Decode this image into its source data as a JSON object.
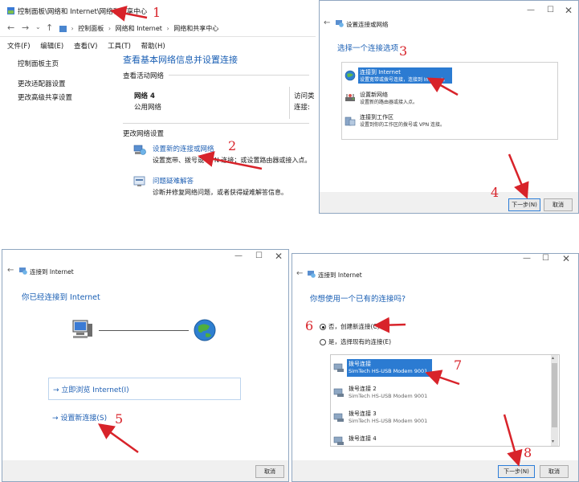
{
  "panel1": {
    "address_title": "控制面板\\网络和 Internet\\网络和共享中心",
    "addr_icon": "control-panel-icon",
    "nav_path": [
      "控制面板",
      "网络和 Internet",
      "网络和共享中心"
    ],
    "menu": [
      "文件(F)",
      "编辑(E)",
      "查看(V)",
      "工具(T)",
      "帮助(H)"
    ],
    "sidebar": [
      "控制面板主页",
      "更改适配器设置",
      "更改高级共享设置"
    ],
    "heading": "查看基本网络信息并设置连接",
    "active_label": "查看活动网络",
    "network_name": "网络 4",
    "network_type": "公用网络",
    "access_type_label": "访问类",
    "connections_label": "连接:",
    "change_label": "更改网络设置",
    "setup_link": "设置新的连接或网络",
    "setup_desc": "设置宽带、拨号或 VPN 连接；或设置路由器或接入点。",
    "troubleshoot_link": "问题疑难解答",
    "troubleshoot_desc": "诊断并修复网络问题，或者获得疑难解答信息。"
  },
  "panel2": {
    "title": "设置连接或网络",
    "heading": "选择一个连接选项",
    "options": [
      {
        "title": "连接到 Internet",
        "desc": "设置宽带或拨号连接，连接到 Internet。",
        "icon": "globe-connect-icon"
      },
      {
        "title": "设置新网络",
        "desc": "设置新的路由器或接入点。",
        "icon": "router-icon"
      },
      {
        "title": "连接到工作区",
        "desc": "设置到你的工作区的拨号或 VPN 连接。",
        "icon": "workplace-icon"
      }
    ],
    "next_label": "下一步(N)",
    "cancel_label": "取消"
  },
  "panel3": {
    "title": "连接到 Internet",
    "heading": "你已经连接到 Internet",
    "browse_link": "→ 立即浏览 Internet(I)",
    "setup_link": "→ 设置新连接(S)",
    "cancel_label": "取消"
  },
  "panel4": {
    "title": "连接到 Internet",
    "heading": "你想使用一个已有的连接吗?",
    "radio_no": "否，创建新连接(C)",
    "radio_yes": "是，选择现有的连接(E)",
    "connections": [
      {
        "name": "拨号连接",
        "device": "SimTech HS-USB Modem 9001"
      },
      {
        "name": "拨号连接 2",
        "device": "SimTech HS-USB Modem 9001"
      },
      {
        "name": "拨号连接 3",
        "device": "SimTech HS-USB Modem 9001"
      },
      {
        "name": "拨号连接 4",
        "device": ""
      }
    ],
    "next_label": "下一步(N)",
    "cancel_label": "取消"
  },
  "steps": [
    "1",
    "2",
    "3",
    "4",
    "5",
    "6",
    "7",
    "8"
  ],
  "colors": {
    "annotation": "#d8232a",
    "selection": "#2b7bd2",
    "link": "#1e5fb3"
  }
}
